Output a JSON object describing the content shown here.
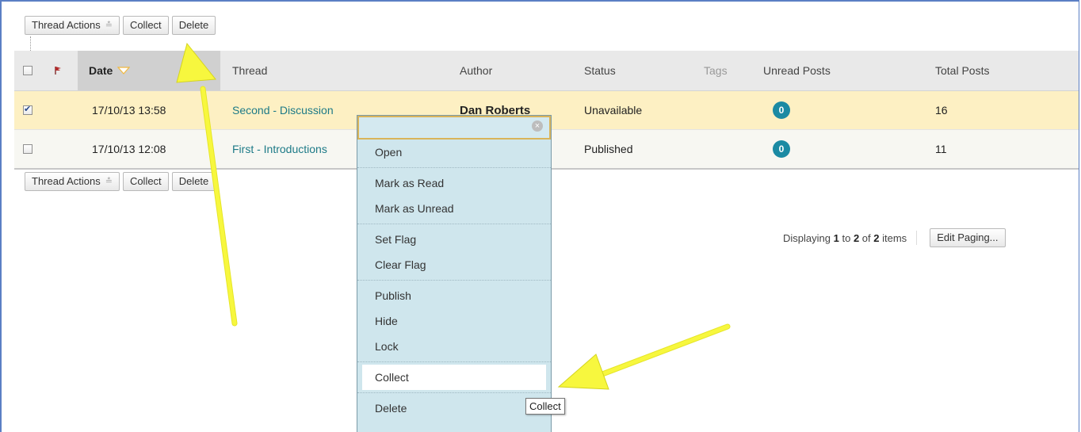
{
  "toolbar": {
    "thread_actions": "Thread Actions",
    "collect": "Collect",
    "delete": "Delete"
  },
  "table": {
    "headers": {
      "date": "Date",
      "thread": "Thread",
      "author": "Author",
      "status": "Status",
      "tags": "Tags",
      "unread": "Unread Posts",
      "total": "Total Posts"
    },
    "rows": [
      {
        "checked": true,
        "date": "17/10/13 13:58",
        "thread": "Second - Discussion",
        "author": "Dan Roberts",
        "status": "Unavailable",
        "unread": "0",
        "total": "16"
      },
      {
        "checked": false,
        "date": "17/10/13 12:08",
        "thread": "First - Introductions",
        "author": "",
        "status": "Published",
        "unread": "0",
        "total": "11"
      }
    ]
  },
  "paging": {
    "prefix": "Displaying",
    "from": "1",
    "to_word": "to",
    "to": "2",
    "of_word": "of",
    "total": "2",
    "suffix": "items",
    "edit": "Edit Paging..."
  },
  "menu": {
    "items": [
      "Open",
      "Mark as Read",
      "Mark as Unread",
      "Set Flag",
      "Clear Flag",
      "Publish",
      "Hide",
      "Lock",
      "Collect",
      "Delete"
    ],
    "highlighted": "Collect"
  },
  "tooltip": "Collect",
  "colors": {
    "arrow": "#f5f53a",
    "selected_row": "#fdf0c3",
    "badge": "#1b8aa3",
    "menu_bg": "#cfe6ed"
  },
  "icons": [
    "flag-icon",
    "sort-chevron-icon",
    "close-icon",
    "double-chevron-icon"
  ]
}
